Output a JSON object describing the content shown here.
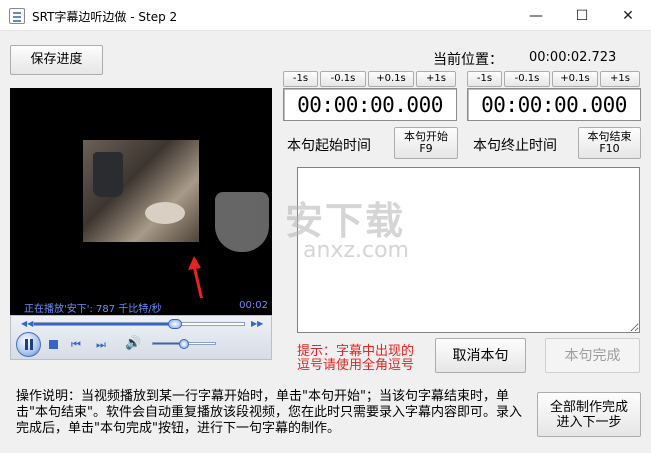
{
  "window": {
    "title": "SRT字幕边听边做 - Step 2",
    "minimize_glyph": "—",
    "maximize_glyph": "☐",
    "close_glyph": "✕"
  },
  "toolbar": {
    "save_progress": "保存进度",
    "current_position_label": "当前位置：",
    "current_position_value": "00:00:02.723"
  },
  "start_time": {
    "adjust": [
      "-1s",
      "-0.1s",
      "+0.1s",
      "+1s"
    ],
    "value": "00:00:00.000",
    "label": "本句起始时间",
    "button": "本句开始\nF9"
  },
  "end_time": {
    "adjust": [
      "-1s",
      "-0.1s",
      "+0.1s",
      "+1s"
    ],
    "value": "00:00:00.000",
    "label": "本句终止时间",
    "button": "本句结束\nF10"
  },
  "player": {
    "status_text": "正在播放'安下': 787 千比特/秒",
    "elapsed": "00:02",
    "seek_fraction": 0.67,
    "volume_fraction": 0.5
  },
  "hint": {
    "line1": "提示：字幕中出现的",
    "line2": "逗号请使用全角逗号"
  },
  "actions": {
    "cancel": "取消本句",
    "complete": "本句完成",
    "finish": "全部制作完成\n进入下一步"
  },
  "instructions": "操作说明：当视频播放到某一行字幕开始时，单击\"本句开始\"；当该句字幕结束时，单击\"本句结束\"。软件会自动重复播放该段视频，您在此时只需要录入字幕内容即可。录入完成后，单击\"本句完成\"按钮，进行下一句字幕的制作。",
  "watermark": {
    "big": "安下载",
    "small": "anxz.com"
  },
  "colors": {
    "hint": "#e8231d",
    "status_text": "#6a8dff",
    "accent": "#3466c8"
  }
}
